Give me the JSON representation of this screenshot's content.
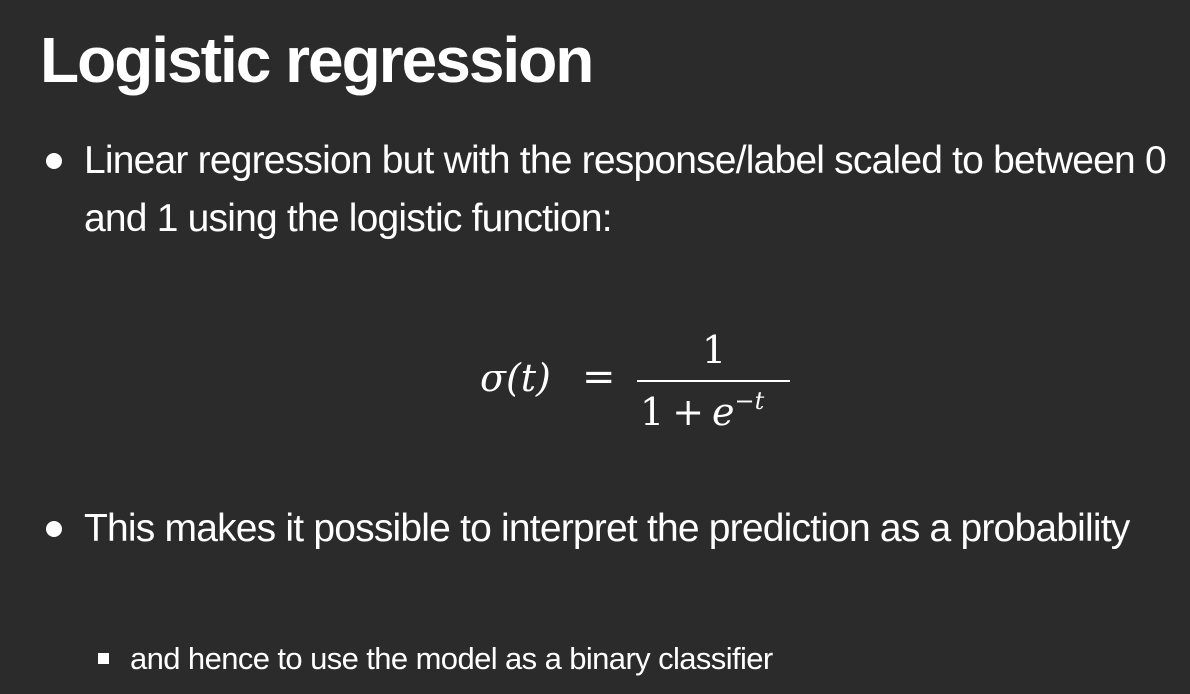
{
  "slide": {
    "title": "Logistic regression",
    "bullets": [
      "Linear regression but with the response/label scaled to between 0 and 1 using the logistic function:",
      "This makes it possible to interpret the prediction as a probability"
    ],
    "sub_bullet": "and hence to use the model as a binary classifier"
  },
  "formula": {
    "lhs": "σ(t)",
    "equals": "=",
    "numerator": "1",
    "denominator_one": "1",
    "plus": "+",
    "base": "e",
    "exponent": "−t"
  },
  "colors": {
    "background": "#2b2b2b",
    "text": "#ffffff"
  }
}
